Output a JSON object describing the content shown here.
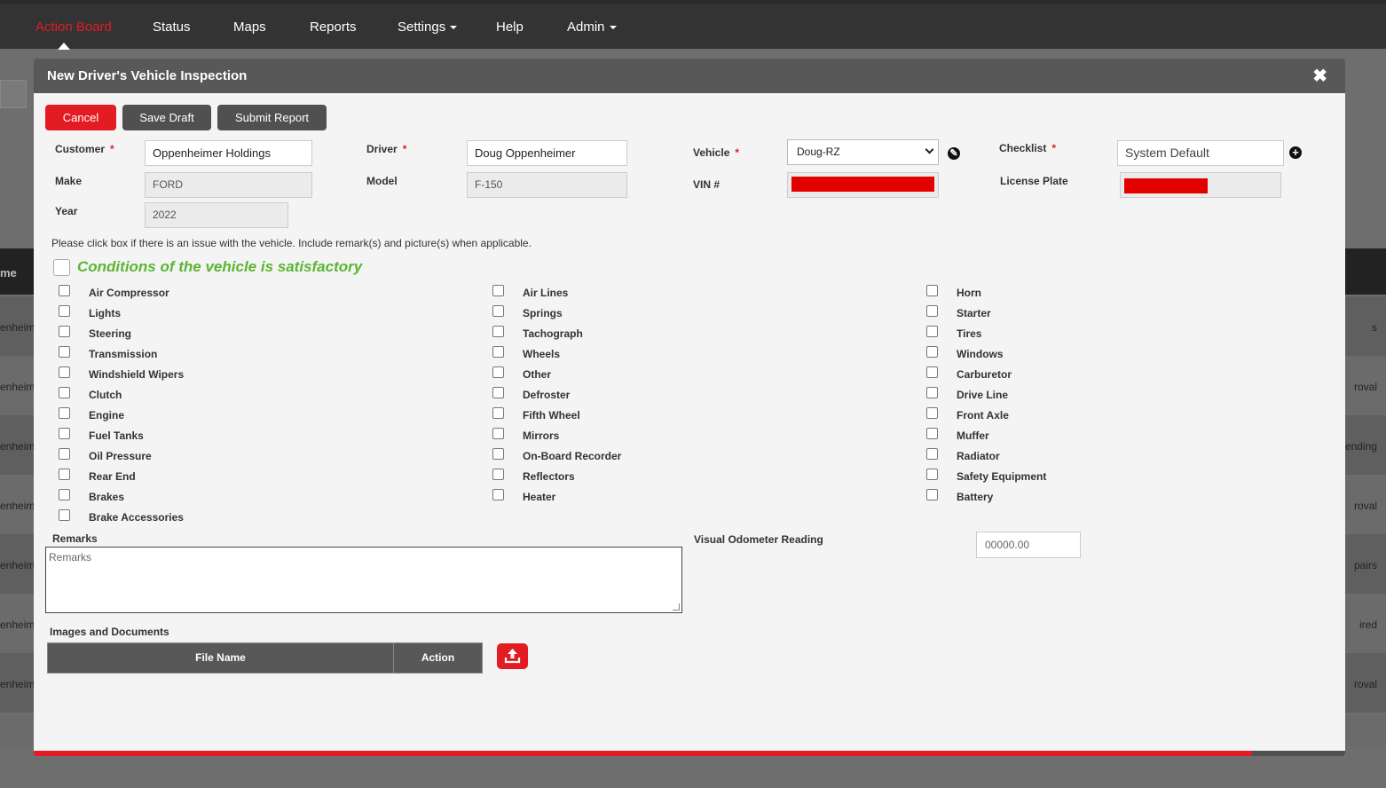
{
  "nav": {
    "items": [
      {
        "label": "Action Board",
        "active": true
      },
      {
        "label": "Status"
      },
      {
        "label": "Maps"
      },
      {
        "label": "Reports"
      },
      {
        "label": "Settings",
        "dropdown": true
      },
      {
        "label": "Help"
      },
      {
        "label": "Admin",
        "dropdown": true
      }
    ]
  },
  "background": {
    "header_label": "me",
    "rows": [
      {
        "left": "enheim",
        "right": "s"
      },
      {
        "left": "enheim",
        "right": "roval"
      },
      {
        "left": "enheim",
        "right": "ending"
      },
      {
        "left": "enheim",
        "right": "roval"
      },
      {
        "left": "enheim",
        "right": "pairs"
      },
      {
        "left": "enheim",
        "right": "ired"
      },
      {
        "left": "enheim",
        "right": "roval"
      }
    ]
  },
  "modal": {
    "title": "New Driver's Vehicle Inspection",
    "close_icon": "close-icon",
    "buttons": {
      "cancel": "Cancel",
      "save_draft": "Save Draft",
      "submit": "Submit Report"
    },
    "fields": {
      "customer_label": "Customer",
      "customer_value": "Oppenheimer Holdings",
      "driver_label": "Driver",
      "driver_value": "Doug Oppenheimer",
      "vehicle_label": "Vehicle",
      "vehicle_value": "Doug-RZ",
      "checklist_label": "Checklist",
      "checklist_value": "System Default",
      "make_label": "Make",
      "make_value": "FORD",
      "model_label": "Model",
      "model_value": "F-150",
      "vin_label": "VIN #",
      "plate_label": "License Plate",
      "year_label": "Year",
      "year_value": "2022",
      "required_mark": "*"
    },
    "instructions": "Please click box if there is an issue with the vehicle. Include remark(s) and picture(s) when applicable.",
    "satisfactory_label": "Conditions of the vehicle is satisfactory",
    "checklist_columns": [
      [
        "Air Compressor",
        "Lights",
        "Steering",
        "Transmission",
        "Windshield Wipers",
        "Clutch",
        "Engine",
        "Fuel Tanks",
        "Oil Pressure",
        "Rear End",
        "Brakes",
        "Brake Accessories"
      ],
      [
        "Air Lines",
        "Springs",
        "Tachograph",
        "Wheels",
        "Other",
        "Defroster",
        "Fifth Wheel",
        "Mirrors",
        "On-Board Recorder",
        "Reflectors",
        "Heater"
      ],
      [
        "Horn",
        "Starter",
        "Tires",
        "Windows",
        "Carburetor",
        "Drive Line",
        "Front Axle",
        "Muffer",
        "Radiator",
        "Safety Equipment",
        "Battery"
      ]
    ],
    "remarks_label": "Remarks",
    "remarks_placeholder": "Remarks",
    "odometer_label": "Visual Odometer Reading",
    "odometer_placeholder": "00000.00",
    "images_label": "Images and Documents",
    "files_table": {
      "col_name": "File Name",
      "col_action": "Action"
    },
    "progress_fraction": 0.929,
    "accent_color": "#e31b23",
    "satisfactory_color": "#5cb531"
  }
}
